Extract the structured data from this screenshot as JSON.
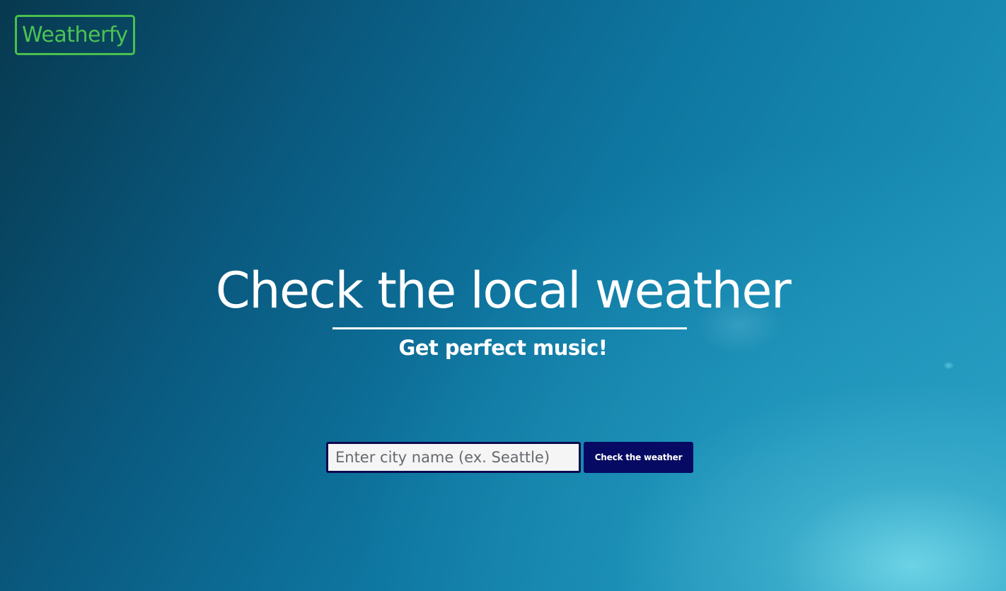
{
  "app": {
    "logo_text": "Weatherfy",
    "accent_color": "#4cc352"
  },
  "hero": {
    "headline": "Check the local weather",
    "subheadline": "Get perfect music!"
  },
  "search": {
    "placeholder": "Enter city name (ex. Seattle)",
    "value": "",
    "button_label": "Check the weather",
    "button_color": "#060a62"
  }
}
